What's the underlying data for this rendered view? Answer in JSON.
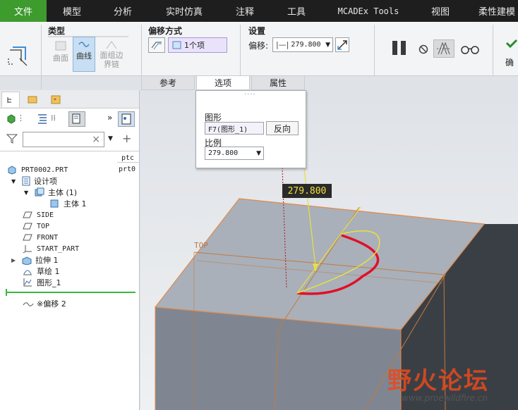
{
  "menu": {
    "tabs": [
      "文件",
      "模型",
      "分析",
      "实时仿真",
      "注释",
      "工具",
      "MCADEx Tools",
      "视图",
      "柔性建模"
    ]
  },
  "ribbon": {
    "type_group": {
      "title": "类型",
      "surface_label": "曲面",
      "curve_label": "曲线",
      "boundary_label": "面组边\n界链"
    },
    "offset_method": {
      "title": "偏移方式",
      "items_label": "1个项"
    },
    "settings": {
      "title": "设置",
      "offset_label": "偏移:",
      "offset_value": "279.800"
    },
    "confirm_label": "确"
  },
  "subtabs": [
    "参考",
    "选项",
    "属性"
  ],
  "popup": {
    "graph_label": "图形",
    "graph_value": "F7(图形_1)",
    "flip_button": "反向",
    "ratio_label": "比例",
    "ratio_value": "279.800"
  },
  "tree": {
    "columns_label": "ptc",
    "col_value": "prt0",
    "items": [
      "PRT0002.PRT",
      "设计项",
      "主体 (1)",
      "主体 1",
      "SIDE",
      "TOP",
      "FRONT",
      "START_PART",
      "拉伸 1",
      "草绘 1",
      "图形_1",
      "※偏移 2"
    ]
  },
  "viewport": {
    "dimension_label": "279.800",
    "plane_label": "TOP",
    "watermark_cn": "野火论坛",
    "watermark_url": "www.proewildfire.cn"
  }
}
